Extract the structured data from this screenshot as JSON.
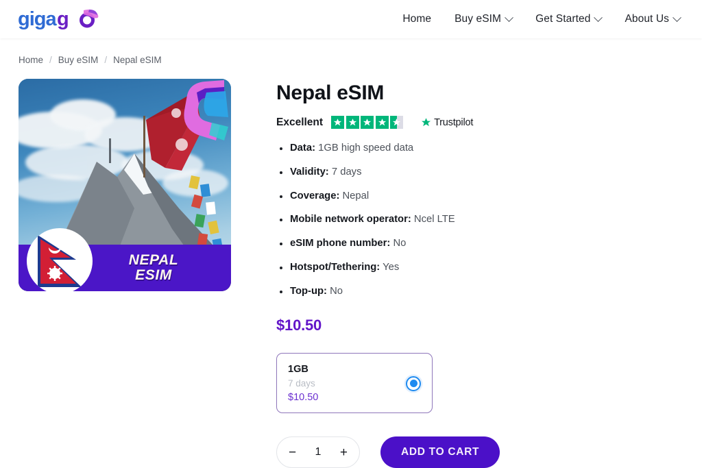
{
  "brand": {
    "logo_text_primary": "giga",
    "logo_text_secondary": "go",
    "colors": {
      "logo_blue": "#2f6bd4",
      "logo_purple": "#6a1fc4",
      "logo_pink": "#e06ce0",
      "accent_purple": "#4b10c8",
      "price_purple": "#6215c9",
      "trustpilot_green": "#00b67a",
      "radio_blue": "#1f8bf0"
    }
  },
  "header": {
    "nav": [
      {
        "label": "Home",
        "has_chevron": false
      },
      {
        "label": "Buy eSIM",
        "has_chevron": true
      },
      {
        "label": "Get Started",
        "has_chevron": true
      },
      {
        "label": "About Us",
        "has_chevron": true
      }
    ]
  },
  "breadcrumb": {
    "items": [
      "Home",
      "Buy eSIM",
      "Nepal eSIM"
    ],
    "separator": "/"
  },
  "product": {
    "title": "Nepal eSIM",
    "image": {
      "banner_line1": "NEPAL",
      "banner_line2": "ESIM",
      "alt": "Nepal mountain landscape with Nepal flag"
    },
    "rating": {
      "label": "Excellent",
      "stars_total": 5,
      "stars_filled": 4.5,
      "provider": "Trustpilot"
    },
    "specs": [
      {
        "label": "Data:",
        "value": "1GB high speed data"
      },
      {
        "label": "Validity:",
        "value": "7 days"
      },
      {
        "label": "Coverage:",
        "value": "Nepal"
      },
      {
        "label": "Mobile network operator:",
        "value": "Ncel LTE"
      },
      {
        "label": "eSIM phone number:",
        "value": "No"
      },
      {
        "label": "Hotspot/Tethering:",
        "value": "Yes"
      },
      {
        "label": "Top-up:",
        "value": "No"
      }
    ],
    "price": "$10.50",
    "plan": {
      "size": "1GB",
      "validity": "7 days",
      "price": "$10.50",
      "selected": true
    },
    "cart": {
      "decrease_label": "−",
      "quantity": "1",
      "increase_label": "+",
      "add_to_cart_label": "ADD TO CART"
    }
  }
}
